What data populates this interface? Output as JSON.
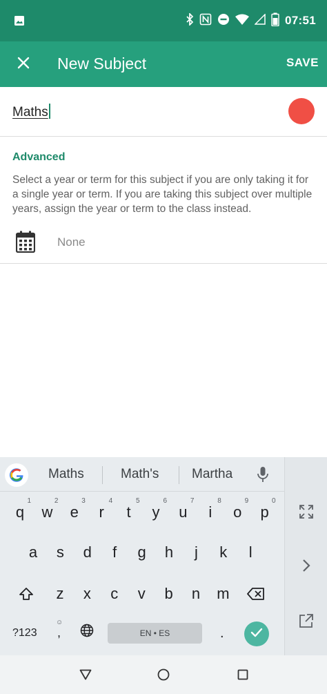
{
  "status_bar": {
    "time": "07:51",
    "icons": [
      "image-icon",
      "bluetooth-icon",
      "nfc-icon",
      "do-not-disturb-icon",
      "wifi-icon",
      "signal-icon",
      "battery-icon"
    ]
  },
  "app_bar": {
    "title": "New Subject",
    "save_label": "SAVE",
    "close_icon": "close-icon",
    "background_color": "#26a07d"
  },
  "subject": {
    "name": "Maths",
    "color": "#f04f45"
  },
  "advanced": {
    "title": "Advanced",
    "description": "Select a year or term for this subject if you are only taking it for a single year or term. If you are taking this subject over multiple years, assign the year or term to the class instead.",
    "year_value": "None",
    "icon": "calendar-icon"
  },
  "keyboard": {
    "suggestions": [
      "Maths",
      "Math's",
      "Martha"
    ],
    "row1": [
      {
        "key": "q",
        "hint": "1"
      },
      {
        "key": "w",
        "hint": "2"
      },
      {
        "key": "e",
        "hint": "3"
      },
      {
        "key": "r",
        "hint": "4"
      },
      {
        "key": "t",
        "hint": "5"
      },
      {
        "key": "y",
        "hint": "6"
      },
      {
        "key": "u",
        "hint": "7"
      },
      {
        "key": "i",
        "hint": "8"
      },
      {
        "key": "o",
        "hint": "9"
      },
      {
        "key": "p",
        "hint": "0"
      }
    ],
    "row2": [
      "a",
      "s",
      "d",
      "f",
      "g",
      "h",
      "j",
      "k",
      "l"
    ],
    "row3": [
      "z",
      "x",
      "c",
      "v",
      "b",
      "n",
      "m"
    ],
    "symbols_label": "?123",
    "comma_label": ",",
    "period_label": ".",
    "space_label": "EN • ES"
  }
}
